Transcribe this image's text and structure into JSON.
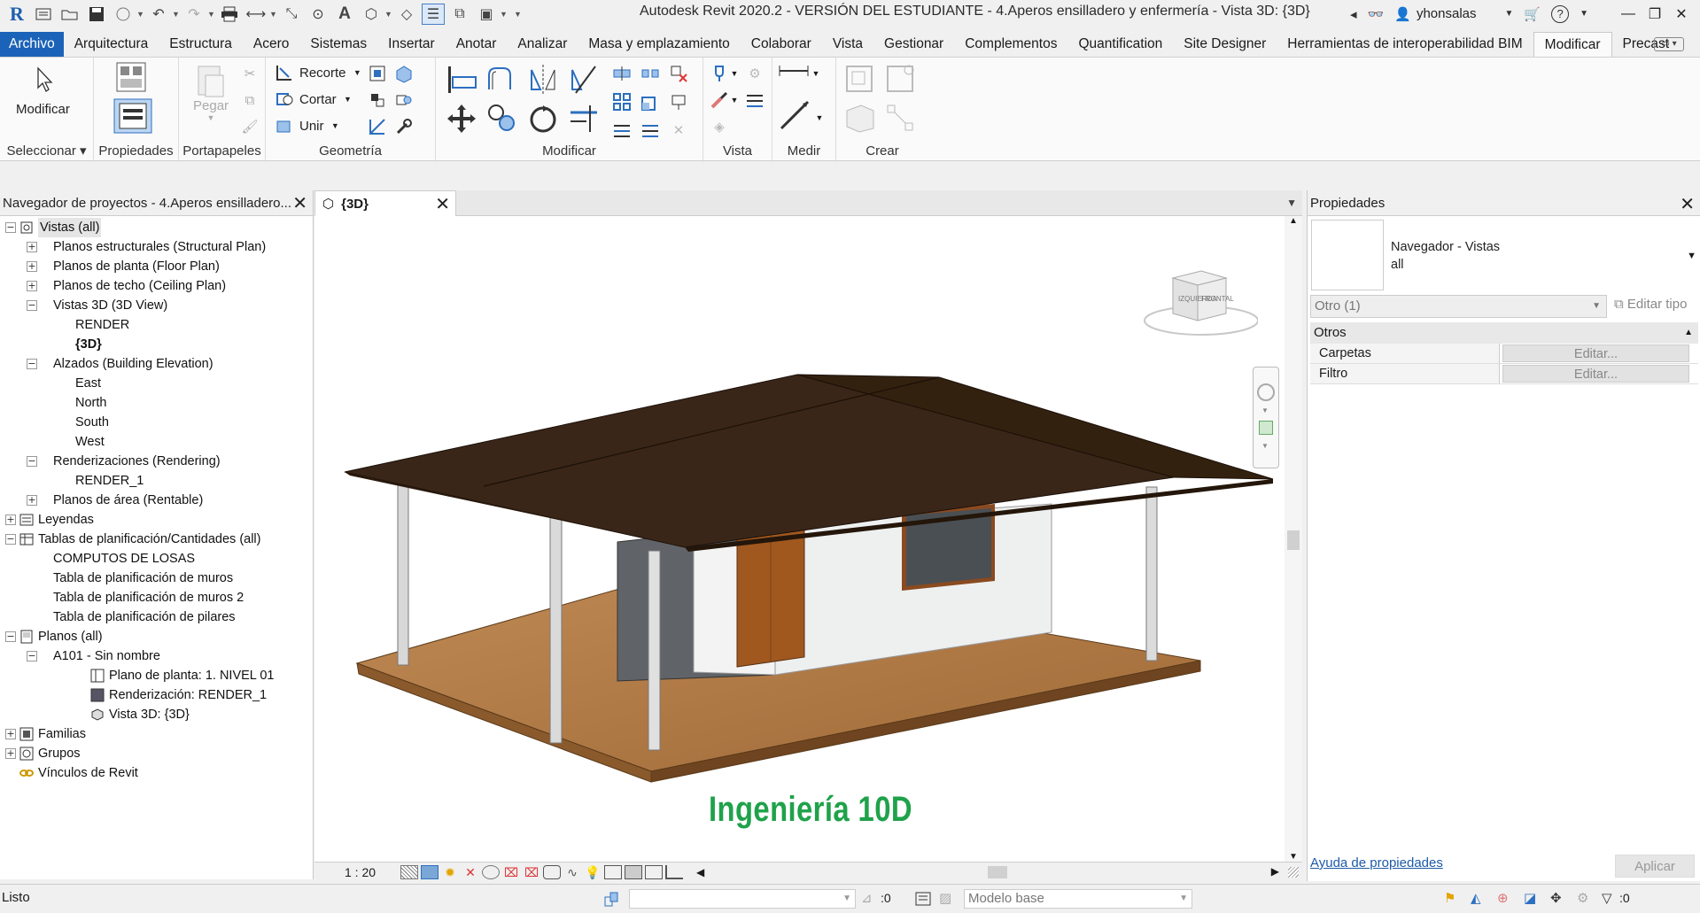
{
  "title_bar": {
    "title": "Autodesk Revit 2020.2 - VERSIÓN DEL ESTUDIANTE - 4.Aperos ensilladero y enfermería - Vista 3D: {3D}",
    "username": "yhonsalas"
  },
  "tabs": [
    "Archivo",
    "Arquitectura",
    "Estructura",
    "Acero",
    "Sistemas",
    "Insertar",
    "Anotar",
    "Analizar",
    "Masa y emplazamiento",
    "Colaborar",
    "Vista",
    "Gestionar",
    "Complementos",
    "Quantification",
    "Site Designer",
    "Herramientas de interoperabilidad BIM",
    "Modificar",
    "Precast"
  ],
  "active_tab": "Modificar",
  "ribbon": {
    "modify_label": "Modificar",
    "paste_label": "Pegar",
    "cope_label": "Recorte",
    "cut_label": "Cortar",
    "join_label": "Unir",
    "panels": {
      "select": "Seleccionar",
      "properties": "Propiedades",
      "clipboard": "Portapapeles",
      "geometry": "Geometría",
      "modify": "Modificar",
      "view": "Vista",
      "measure": "Medir",
      "create": "Crear"
    }
  },
  "browser": {
    "header": "Navegador de proyectos - 4.Aperos ensilladero...",
    "nodes": [
      {
        "label": "Vistas (all)",
        "level": 0,
        "expander": "−",
        "icon": "views-icon",
        "selected": true
      },
      {
        "label": "Planos estructurales (Structural Plan)",
        "level": 1,
        "expander": "+"
      },
      {
        "label": "Planos de planta (Floor Plan)",
        "level": 1,
        "expander": "+"
      },
      {
        "label": "Planos de techo (Ceiling Plan)",
        "level": 1,
        "expander": "+"
      },
      {
        "label": "Vistas 3D (3D View)",
        "level": 1,
        "expander": "−"
      },
      {
        "label": "RENDER",
        "level": 2
      },
      {
        "label": "{3D}",
        "level": 2,
        "bold": true
      },
      {
        "label": "Alzados (Building Elevation)",
        "level": 1,
        "expander": "−"
      },
      {
        "label": "East",
        "level": 2
      },
      {
        "label": "North",
        "level": 2
      },
      {
        "label": "South",
        "level": 2
      },
      {
        "label": "West",
        "level": 2
      },
      {
        "label": "Renderizaciones (Rendering)",
        "level": 1,
        "expander": "−"
      },
      {
        "label": "RENDER_1",
        "level": 2
      },
      {
        "label": "Planos de área (Rentable)",
        "level": 1,
        "expander": "+"
      },
      {
        "label": "Leyendas",
        "level": 0,
        "expander": "+",
        "icon": "legend-icon"
      },
      {
        "label": "Tablas de planificación/Cantidades (all)",
        "level": 0,
        "expander": "−",
        "icon": "schedule-icon"
      },
      {
        "label": "COMPUTOS DE LOSAS",
        "level": 1
      },
      {
        "label": "Tabla de planificación de muros",
        "level": 1
      },
      {
        "label": "Tabla de planificación de muros 2",
        "level": 1
      },
      {
        "label": "Tabla de planificación de pilares",
        "level": 1
      },
      {
        "label": "Planos (all)",
        "level": 0,
        "expander": "−",
        "icon": "sheets-icon"
      },
      {
        "label": "A101 - Sin nombre",
        "level": 1,
        "expander": "−"
      },
      {
        "label": "Plano de planta: 1. NIVEL 01",
        "level": 3,
        "icon": "floorplan-icon"
      },
      {
        "label": "Renderización: RENDER_1",
        "level": 3,
        "icon": "render-icon"
      },
      {
        "label": "Vista 3D: {3D}",
        "level": 3,
        "icon": "view3d-icon"
      },
      {
        "label": "Familias",
        "level": 0,
        "expander": "+",
        "icon": "families-icon"
      },
      {
        "label": "Grupos",
        "level": 0,
        "expander": "+",
        "icon": "groups-icon"
      },
      {
        "label": "Vínculos de Revit",
        "level": 0,
        "icon": "links-icon"
      }
    ]
  },
  "view": {
    "tab_label": "{3D}",
    "scale": "1 : 20",
    "watermark": "Ingeniería 10D",
    "viewcube_left_face": "IZQUIERDA",
    "viewcube_front_face": "FRONTAL"
  },
  "properties": {
    "header": "Propiedades",
    "type_name_line1": "Navegador - Vistas",
    "type_name_line2": "all",
    "instance_selector": "Otro (1)",
    "edit_type": "Editar tipo",
    "group": "Otros",
    "rows": [
      {
        "key": "Carpetas",
        "value": "Editar..."
      },
      {
        "key": "Filtro",
        "value": "Editar..."
      }
    ],
    "help_link": "Ayuda de propiedades",
    "apply": "Aplicar"
  },
  "status": {
    "text": "Listo",
    "worksets_count": ":0",
    "model": "Modelo base",
    "filter_count": ":0"
  },
  "colors": {
    "accent": "#1b63b8",
    "watermark": "#1fa24a",
    "roof": "#3a2618",
    "deck": "#b07a47",
    "door": "#a0581f"
  }
}
